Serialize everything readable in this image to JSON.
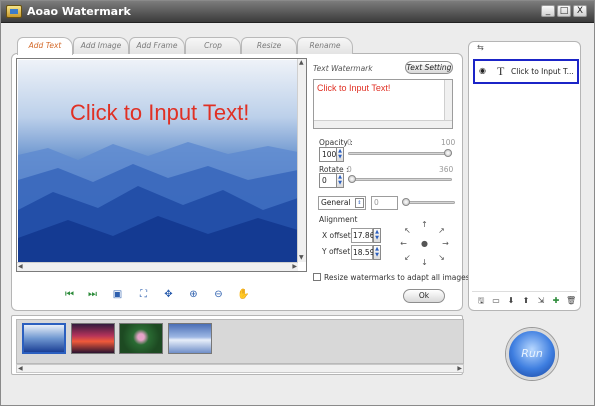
{
  "window": {
    "title": "Aoao Watermark",
    "minimize": "_",
    "maximize": "□",
    "close": "X"
  },
  "tabs": [
    {
      "label": "Add Text",
      "active": true
    },
    {
      "label": "Add Image",
      "active": false
    },
    {
      "label": "Add Frame",
      "active": false
    },
    {
      "label": "Crop",
      "active": false
    },
    {
      "label": "Resize",
      "active": false
    },
    {
      "label": "Rename",
      "active": false
    }
  ],
  "preview": {
    "watermark_text": "Click to Input Text!"
  },
  "text_panel": {
    "header": "Text Watermark",
    "setting_button": "Text Setting",
    "text_value": "Click to Input Text!",
    "opacity_label": "Opacity :",
    "opacity_min": "0",
    "opacity_max": "100",
    "opacity_value": "100",
    "rotate_label": "Rotate :",
    "rotate_min": "0",
    "rotate_max": "360",
    "rotate_value": "0",
    "mode_value": "General",
    "mode_number": "0",
    "alignment_label": "Alignment",
    "x_offset_label": "X offset:",
    "x_offset_value": "17.86",
    "y_offset_label": "Y offset:",
    "y_offset_value": "18.59",
    "resize_checkbox_label": "Resize watermarks to adapt all images.",
    "resize_checked": false,
    "ok_button": "Ok"
  },
  "preview_controls": [
    "first-icon",
    "last-icon",
    "fit-icon",
    "fullscreen-icon",
    "move-icon",
    "zoom-in-icon",
    "zoom-out-icon",
    "hand-icon"
  ],
  "layers": [
    {
      "label": "Click to Input T...",
      "type": "T"
    }
  ],
  "layer_tools": [
    "save-icon",
    "open-icon",
    "move-down-icon",
    "move-up-icon",
    "export-icon",
    "add-icon",
    "delete-icon"
  ],
  "run_button": "Run",
  "colors": {
    "accent_tab": "#d46a2a",
    "watermark_text": "#e03024",
    "selection": "#1b24c7"
  }
}
